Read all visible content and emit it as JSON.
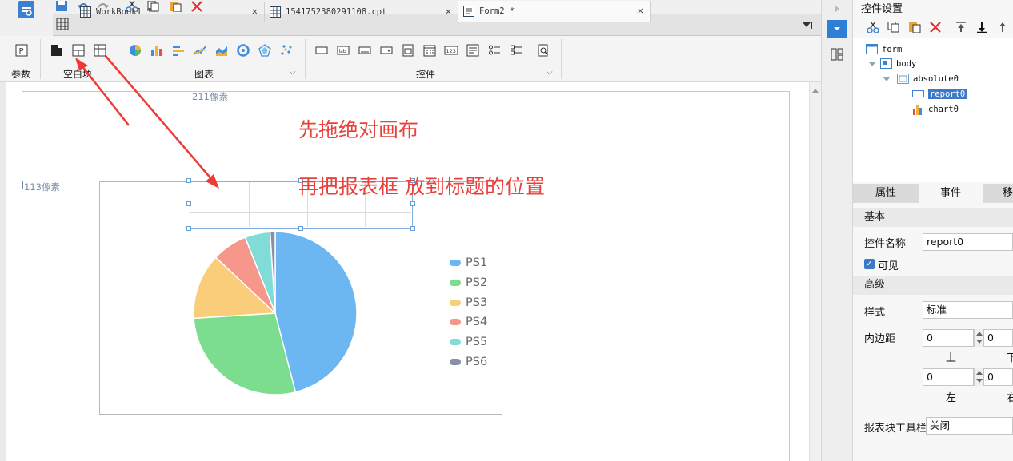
{
  "tabs": [
    {
      "label": "WorkBook1 *",
      "active": false
    },
    {
      "label": "1541752380291108.cpt",
      "active": false
    },
    {
      "label": "Form2 *",
      "active": true
    }
  ],
  "ribbon": {
    "param_label": "参数",
    "blank_block_label": "空白块",
    "chart_label": "图表",
    "widget_label": "控件"
  },
  "canvas": {
    "width_label": "211像素",
    "height_label": "113像素",
    "annotation_1": "先拖绝对画布",
    "annotation_2": "再把报表框  放到标题的位置"
  },
  "chart_data": {
    "type": "pie",
    "categories": [
      "PS1",
      "PS2",
      "PS3",
      "PS4",
      "PS5",
      "PS6"
    ],
    "values": [
      46,
      28,
      13,
      7,
      5,
      1
    ],
    "colors": [
      "#6cb6f2",
      "#7ddd8f",
      "#f9cd7a",
      "#f5978a",
      "#7fdcd6",
      "#8a8fa8"
    ]
  },
  "panel": {
    "title": "控件设置",
    "tree": {
      "form": "form",
      "body": "body",
      "absolute": "absolute0",
      "report": "report0",
      "chart": "chart0"
    },
    "tabs": [
      "属性",
      "事件",
      "移"
    ],
    "basic_header": "基本",
    "name_label": "控件名称",
    "name_value": "report0",
    "visible_label": "可见",
    "advanced_header": "高级",
    "style_label": "样式",
    "style_value": "标准",
    "padding_label": "内边距",
    "pad_top_value": "0",
    "pad_bottom_value": "0",
    "pad_left_value": "0",
    "pad_right_value": "0",
    "top_label": "上",
    "bottom_label": "下",
    "left_label": "左",
    "right_label": "右",
    "toolbar_label": "报表块工具栏",
    "toolbar_value": "关闭"
  },
  "icon_names": [
    "save-icon",
    "undo-icon",
    "redo-icon",
    "cut-icon",
    "copy-icon",
    "paste-icon",
    "delete-icon"
  ]
}
